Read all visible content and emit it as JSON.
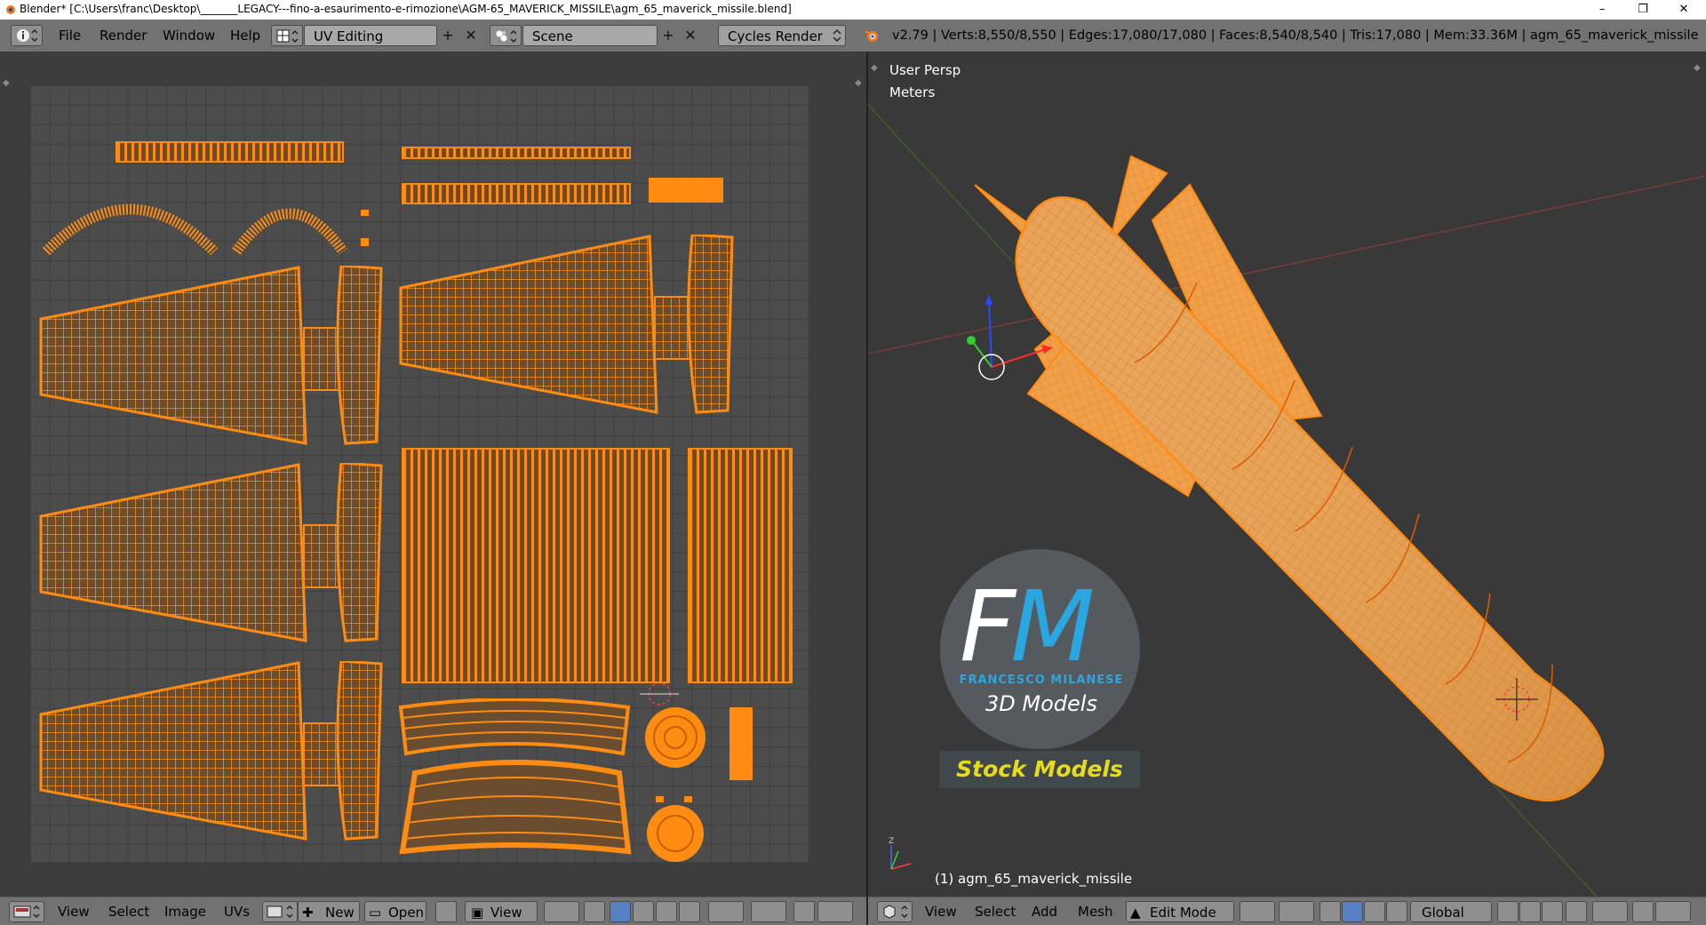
{
  "title_bar": {
    "title": "Blender* [C:\\Users\\franc\\Desktop\\_______LEGACY---fino-a-esaurimento-e-rimozione\\AGM-65_MAVERICK_MISSILE\\agm_65_maverick_missile.blend]",
    "minimize": "–",
    "restore": "❐",
    "close": "✕"
  },
  "info_header": {
    "menus": [
      "File",
      "Render",
      "Window",
      "Help"
    ],
    "screen_layout": "UV Editing",
    "scene": "Scene",
    "render_engine": "Cycles Render",
    "stats": "v2.79 | Verts:8,550/8,550 | Edges:17,080/17,080 | Faces:8,540/8,540 | Tris:17,080 | Mem:33.36M | agm_65_maverick_missile"
  },
  "uv_editor": {
    "footer_menus": [
      "View",
      "Select",
      "Image",
      "UVs"
    ],
    "new_label": "New",
    "open_label": "Open",
    "view_label": "View"
  },
  "viewport": {
    "view_name": "User Persp",
    "units": "Meters",
    "object_label": "(1) agm_65_maverick_missile",
    "footer_menus": [
      "View",
      "Select",
      "Add",
      "Mesh"
    ],
    "mode": "Edit Mode",
    "orientation": "Global"
  },
  "watermark": {
    "letter_f": "F",
    "letter_m": "M",
    "name": "FRANCESCO MILANESE",
    "subtitle": "3D Models",
    "stock": "Stock Models"
  },
  "colors": {
    "mesh": "#ff8c12",
    "header": "#727272",
    "uv_grid": "#4c4c4c",
    "brand_blue": "#2aa6e0",
    "stock_yellow": "#e5dd1a"
  }
}
